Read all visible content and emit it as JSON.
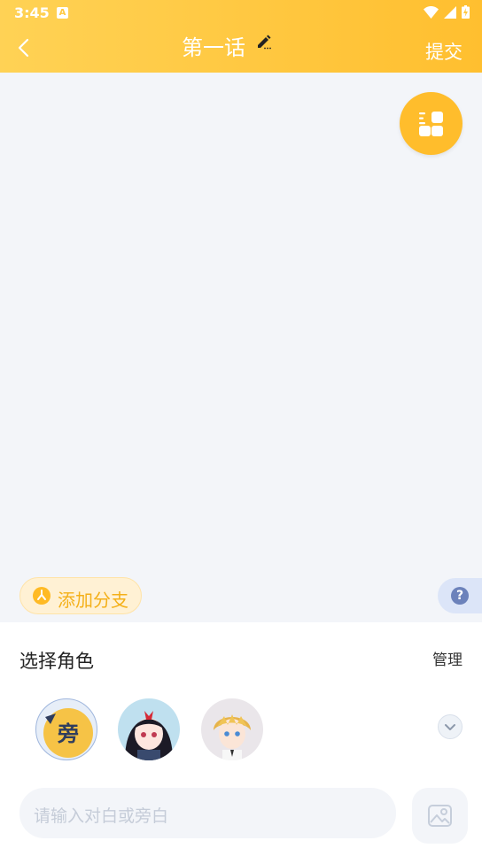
{
  "status": {
    "time": "3:45",
    "app_icon": "A"
  },
  "header": {
    "title": "第一话",
    "submit": "提交"
  },
  "branch": {
    "label": "添加分支"
  },
  "help": {
    "label": "?"
  },
  "panel": {
    "title": "选择角色",
    "manage": "管理",
    "narrator": "旁",
    "input_placeholder": "请输入对白或旁白"
  },
  "colors": {
    "accent": "#ffbd2c",
    "bg": "#f3f5f9",
    "help": "#6c82bb"
  }
}
